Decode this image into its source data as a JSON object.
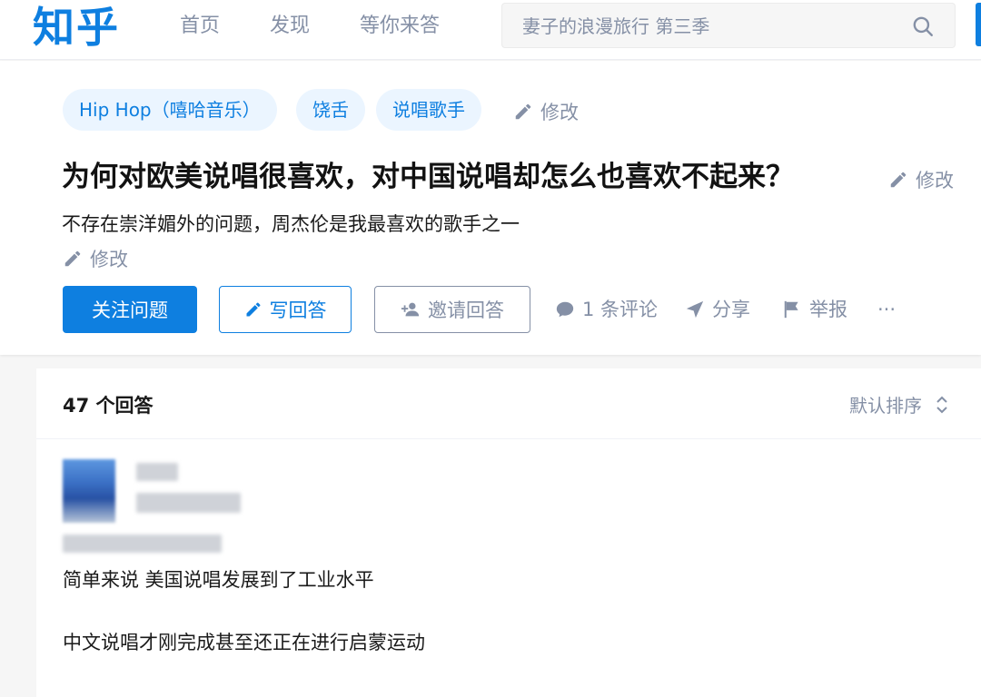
{
  "header": {
    "logo": "知乎",
    "nav": [
      "首页",
      "发现",
      "等你来答"
    ],
    "search_placeholder": "妻子的浪漫旅行 第三季"
  },
  "question": {
    "tags": [
      "Hip Hop（嘻哈音乐）",
      "饶舌",
      "说唱歌手"
    ],
    "edit_label": "修改",
    "title": "为何对欧美说唱很喜欢，对中国说唱却怎么也喜欢不起来？",
    "detail": "不存在崇洋媚外的问题，周杰伦是我最喜欢的歌手之一",
    "buttons": {
      "follow": "关注问题",
      "answer": "写回答",
      "invite": "邀请回答"
    },
    "actions": {
      "comments": "1 条评论",
      "share": "分享",
      "report": "举报",
      "more": "···"
    }
  },
  "answers": {
    "count_label": "47 个回答",
    "sort_label": "默认排序",
    "first_answer": {
      "paragraphs": [
        "简单来说 美国说唱发展到了工业水平",
        "中文说唱才刚完成甚至还正在进行启蒙运动"
      ]
    }
  },
  "colors": {
    "brand": "#0e7fe0",
    "muted": "#8590a6",
    "tag_bg": "#ebf5ff"
  },
  "icons": [
    "search-icon",
    "pencil-icon",
    "add-user-icon",
    "comment-icon",
    "paper-plane-icon",
    "flag-icon",
    "sort-arrows-icon"
  ]
}
